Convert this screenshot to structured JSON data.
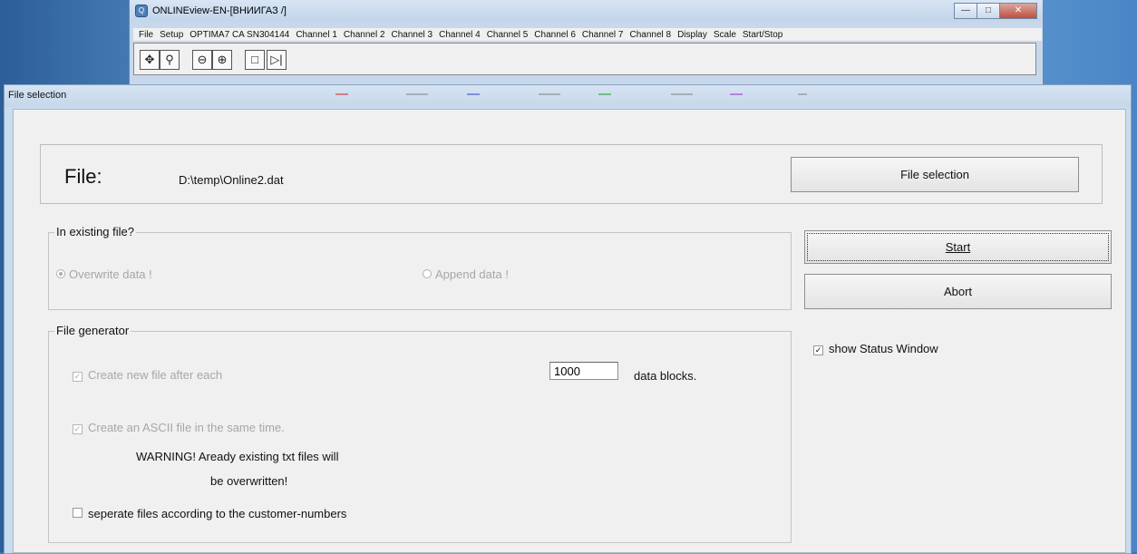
{
  "bg_window": {
    "title": "ONLINEview-EN-[ВНИИГАЗ     /]",
    "menu": [
      "File",
      "Setup",
      "OPTIMA7 CA SN304144",
      "Channel 1",
      "Channel 2",
      "Channel 3",
      "Channel 4",
      "Channel 5",
      "Channel 6",
      "Channel 7",
      "Channel 8",
      "Display",
      "Scale",
      "Start/Stop"
    ]
  },
  "dialog": {
    "title": "File selection",
    "file_label": "File:",
    "file_path": "D:\\temp\\Online2.dat",
    "file_selection_button": "File selection",
    "start_button": "Start",
    "abort_button": "Abort",
    "show_status_label": "show Status Window",
    "existing": {
      "legend": "In existing file?",
      "overwrite_label": "Overwrite data !",
      "append_label": "Append data !"
    },
    "generator": {
      "legend": "File generator",
      "create_new_label": "Create new file after each",
      "blocks_value": "1000",
      "blocks_suffix": "data blocks.",
      "ascii_label": "Create an ASCII file in the same time.",
      "warning_line1": "WARNING! Aready existing txt files will",
      "warning_line2": "be overwritten!",
      "separate_label": "seperate files according to the customer-numbers"
    }
  }
}
